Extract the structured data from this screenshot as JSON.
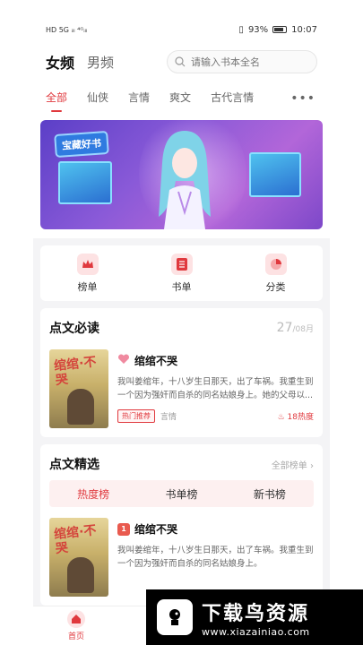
{
  "status": {
    "carrier": "HD 5G ᵢₗₗ ⁴ᴳᵢₗₗ",
    "battery_pct": "93%",
    "time": "10:07"
  },
  "header": {
    "tabs": [
      {
        "label": "女频",
        "active": true
      },
      {
        "label": "男频",
        "active": false
      }
    ],
    "search_placeholder": "请输入书本全名"
  },
  "categories": {
    "items": [
      "全部",
      "仙侠",
      "言情",
      "爽文",
      "古代言情"
    ],
    "active_index": 0,
    "more": "•••"
  },
  "banner": {
    "tag": "宝藏好书"
  },
  "quick_entries": [
    {
      "label": "榜单",
      "icon": "crown-icon"
    },
    {
      "label": "书单",
      "icon": "list-icon"
    },
    {
      "label": "分类",
      "icon": "pie-icon"
    }
  ],
  "must_read": {
    "title": "点文必读",
    "date_day": "27",
    "date_month": "/08月",
    "book": {
      "title": "绾绾不哭",
      "cover_text": "绾绾·不哭",
      "desc": "我叫姜绾年，十八岁生日那天，出了车祸。我重生到一个因为强奸而自杀的同名姑娘身上。她的父母以...",
      "badge": "热门推荐",
      "genre": "言情",
      "heat": "18热度"
    }
  },
  "selected": {
    "title": "点文精选",
    "all_rank": "全部榜单",
    "tabs": [
      {
        "label": "热度榜",
        "active": true
      },
      {
        "label": "书单榜",
        "active": false
      },
      {
        "label": "新书榜",
        "active": false
      }
    ],
    "book": {
      "title": "绾绾不哭",
      "rank": "1",
      "cover_text": "绾绾·不哭",
      "desc": "我叫姜绾年，十八岁生日那天，出了车祸。我重生到一个因为强奸而自杀的同名姑娘身上。"
    }
  },
  "nav": {
    "home": "首页"
  },
  "watermark": {
    "name": "下载鸟资源",
    "url": "www.xiazainiao.com"
  },
  "colors": {
    "accent": "#e0393e"
  }
}
